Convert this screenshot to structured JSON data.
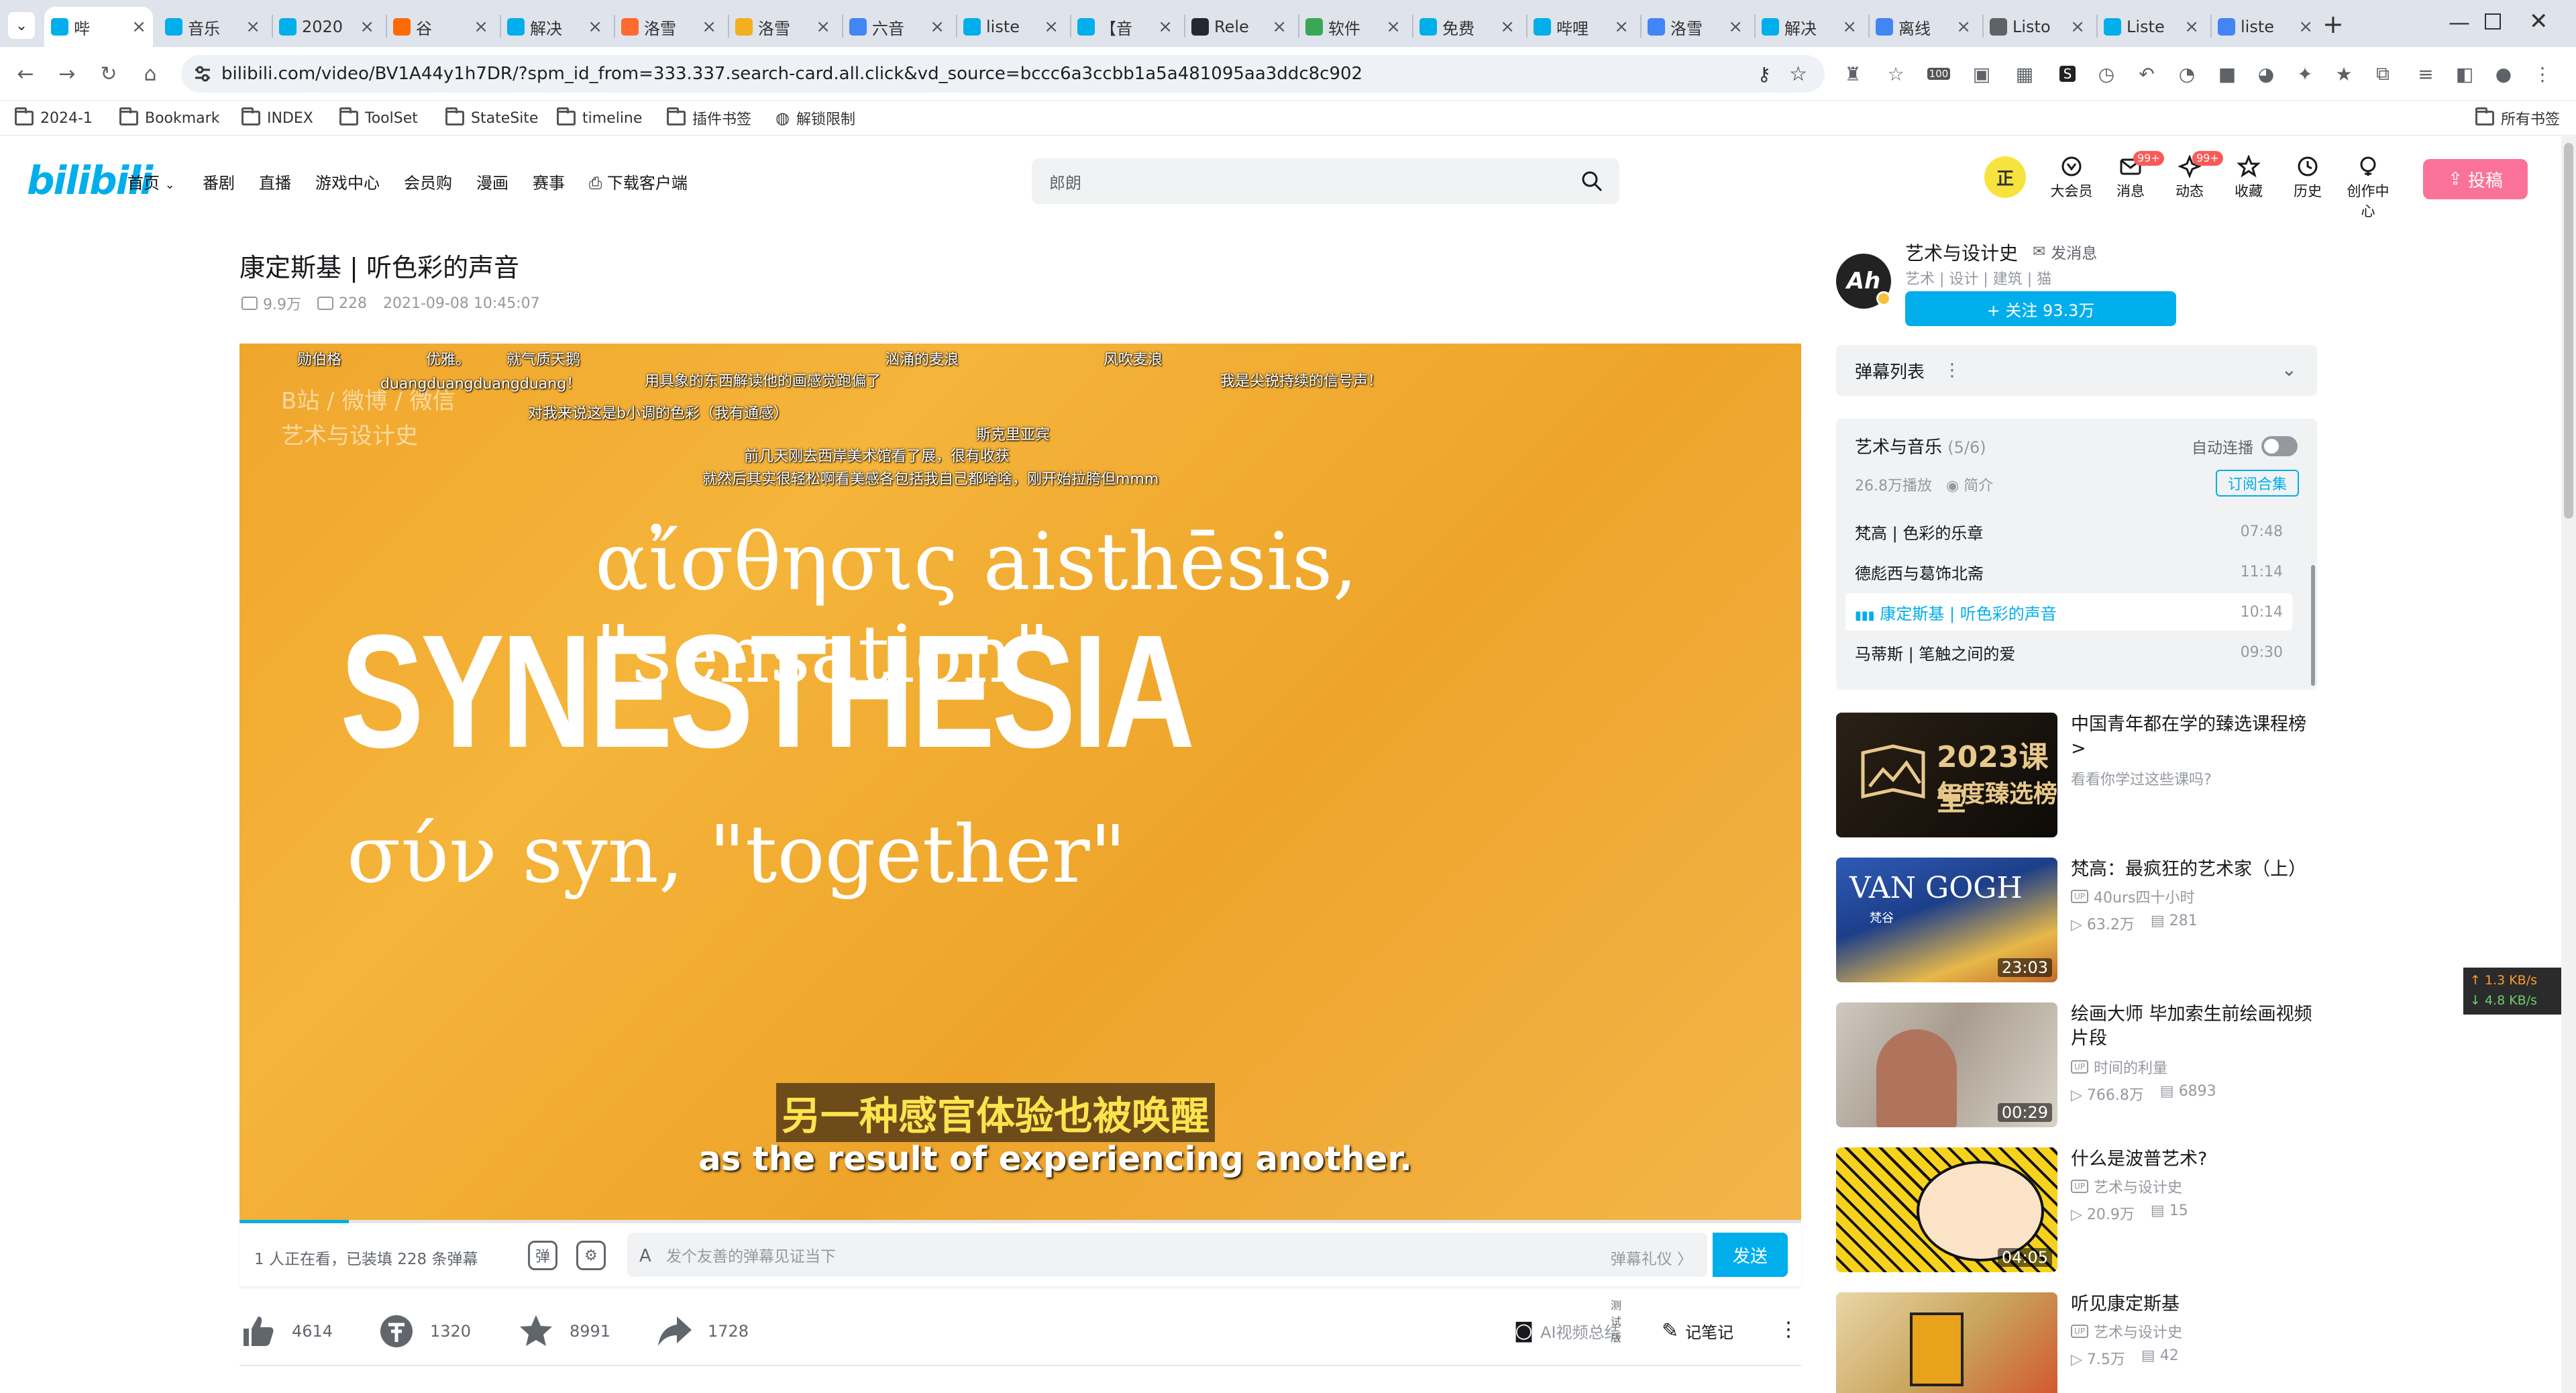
{
  "browser": {
    "tabs": [
      {
        "label": "哔",
        "active": true,
        "color": "#00aeec",
        "icon": "bilibili-icon"
      },
      {
        "label": "音乐",
        "color": "#00aeec",
        "icon": "bilibili-icon"
      },
      {
        "label": "2020",
        "color": "#00aeec",
        "icon": "bilibili-icon"
      },
      {
        "label": "谷",
        "color": "#ff6a00",
        "icon": "refresh-icon"
      },
      {
        "label": "解决",
        "color": "#00aeec",
        "icon": "bilibili-icon"
      },
      {
        "label": "洛雪",
        "color": "#ff6a2e",
        "icon": "flag-icon"
      },
      {
        "label": "洛雪",
        "color": "#f2b01e",
        "icon": "smile-icon"
      },
      {
        "label": "六音",
        "color": "#4285f4",
        "icon": "google-icon"
      },
      {
        "label": "liste",
        "color": "#00aeec",
        "icon": "bilibili-icon"
      },
      {
        "label": "【音",
        "color": "#00aeec",
        "icon": "bilibili-icon"
      },
      {
        "label": "Rele",
        "color": "#24292f",
        "icon": "github-icon"
      },
      {
        "label": "软件",
        "color": "#3aa757",
        "icon": "leaf-icon"
      },
      {
        "label": "免费",
        "color": "#00aeec",
        "icon": "bilibili-icon"
      },
      {
        "label": "哔哩",
        "color": "#00aeec",
        "icon": "bilibili-icon"
      },
      {
        "label": "洛雪",
        "color": "#4285f4",
        "icon": "google-icon"
      },
      {
        "label": "解决",
        "color": "#00aeec",
        "icon": "bilibili-icon"
      },
      {
        "label": "离线",
        "color": "#4285f4",
        "icon": "google-icon"
      },
      {
        "label": "Listo",
        "color": "#5f6368",
        "icon": "globe-icon"
      },
      {
        "label": "Liste",
        "color": "#00aeec",
        "icon": "bilibili-icon"
      },
      {
        "label": "liste",
        "color": "#4285f4",
        "icon": "google-icon"
      }
    ],
    "new_tab": "+",
    "url": "bilibili.com/video/BV1A44y1h7DR/?spm_id_from=333.337.search-card.all.click&vd_source=bccc6a3ccbb1a5a481095aa3ddc8c902",
    "bookmarks": [
      "2024-1",
      "Bookmark",
      "INDEX",
      "ToolSet",
      "StateSite",
      "timeline",
      "插件书签",
      "解锁限制"
    ],
    "all_bookmarks": "所有书签",
    "ext_badge": "100"
  },
  "site": {
    "logo": "bilibili",
    "nav": [
      "首页",
      "番剧",
      "直播",
      "游戏中心",
      "会员购",
      "漫画",
      "赛事",
      "下载客户端"
    ],
    "search_placeholder": "郎朗",
    "user_avatar_text": "正",
    "header_icons": [
      {
        "label": "大会员",
        "badge": ""
      },
      {
        "label": "消息",
        "badge": "99+"
      },
      {
        "label": "动态",
        "badge": "99+"
      },
      {
        "label": "收藏",
        "badge": ""
      },
      {
        "label": "历史",
        "badge": ""
      },
      {
        "label": "创作中心",
        "badge": ""
      }
    ],
    "upload_label": "投稿"
  },
  "video": {
    "title": "康定斯基 | 听色彩的声音",
    "views": "9.9万",
    "danmaku_count": "228",
    "date": "2021-09-08 10:45:07",
    "progress": 0.07,
    "watermark_line1": "B站 / 微博 / 微信",
    "watermark_line2": "艺术与设计史",
    "greek_line1": "αἴσθησις aisthēsis, \"sensation\"",
    "big_word": "SYNESTHESIA",
    "greek_line2": "σύν syn, \"together\"",
    "subtitle_cn": "另一种感官体验也被唤醒",
    "subtitle_en": "as the result of experiencing another.",
    "danmaku": [
      "勋伯格",
      "优雅。",
      "就气质天鹅",
      "汹涌的麦浪",
      "风吹麦浪",
      "duangduangduangduang！",
      "用具象的东西解读他的画感觉跑偏了",
      "我是尖锐持续的信号声！",
      "对我来说这是b小调的色彩（我有通感）",
      "斯克里亚宾",
      "前几天刚去西岸美术馆看了展，很有收获",
      "就然后其实很轻松啊看美感各包括我自己都啥啥，刚开始拉胯但mmm"
    ]
  },
  "danmaku_bar": {
    "watching": "1 人正在看，已装填 228 条弹幕",
    "placeholder": "发个友善的弹幕见证当下",
    "etiquette": "弹幕礼仪 〉",
    "send": "发送"
  },
  "toolbar": {
    "like": "4614",
    "coin": "1320",
    "fav": "8991",
    "share": "1728",
    "ai_summary": "AI视频总结",
    "beta": "测试版",
    "notes": "记笔记"
  },
  "uploader": {
    "name": "艺术与设计史",
    "message": "发消息",
    "desc": "艺术 | 设计 | 建筑 | 猫",
    "follow": "+ 关注 93.3万",
    "avatar_text": "Ah"
  },
  "danmaku_list": {
    "label": "弹幕列表",
    "more": "⋮",
    "chevron": "⌄"
  },
  "collection": {
    "title": "艺术与音乐",
    "count": "(5/6)",
    "autoplay": "自动连播",
    "stats": "26.8万播放",
    "intro": "简介",
    "subscribe": "订阅合集",
    "episodes": [
      {
        "title": "梵高 | 色彩的乐章",
        "duration": "07:48",
        "current": false
      },
      {
        "title": "德彪西与葛饰北斋",
        "duration": "11:14",
        "current": false
      },
      {
        "title": "康定斯基 | 听色彩的声音",
        "duration": "10:14",
        "current": true
      },
      {
        "title": "马蒂斯 | 笔触之间的爱",
        "duration": "09:30",
        "current": false
      }
    ]
  },
  "recommendations": [
    {
      "title": "中国青年都在学的臻选课程榜 >",
      "sub": "看看你学过这些课吗?",
      "up": "",
      "views": "",
      "danmaku": "",
      "duration": "",
      "thumb_text1": "2023课堂",
      "thumb_text2": "年度臻选榜"
    },
    {
      "title": "梵高：最疯狂的艺术家（上）",
      "sub": "",
      "up": "40urs四十小时",
      "views": "63.2万",
      "danmaku": "281",
      "duration": "23:03",
      "thumb_text1": "VAN GOGH",
      "thumb_text2": "梵谷"
    },
    {
      "title": "绘画大师 毕加索生前绘画视频片段",
      "sub": "",
      "up": "时间的利量",
      "views": "766.8万",
      "danmaku": "6893",
      "duration": "00:29",
      "thumb_text1": "",
      "thumb_text2": ""
    },
    {
      "title": "什么是波普艺术?",
      "sub": "",
      "up": "艺术与设计史",
      "views": "20.9万",
      "danmaku": "15",
      "duration": "04:05",
      "thumb_text1": "",
      "thumb_text2": ""
    },
    {
      "title": "听见康定斯基",
      "sub": "",
      "up": "艺术与设计史",
      "views": "7.5万",
      "danmaku": "42",
      "duration": "",
      "thumb_text1": "",
      "thumb_text2": ""
    }
  ],
  "netspeed": {
    "up": "↑ 1.3 KB/s",
    "down": "↓ 4.8 KB/s"
  }
}
